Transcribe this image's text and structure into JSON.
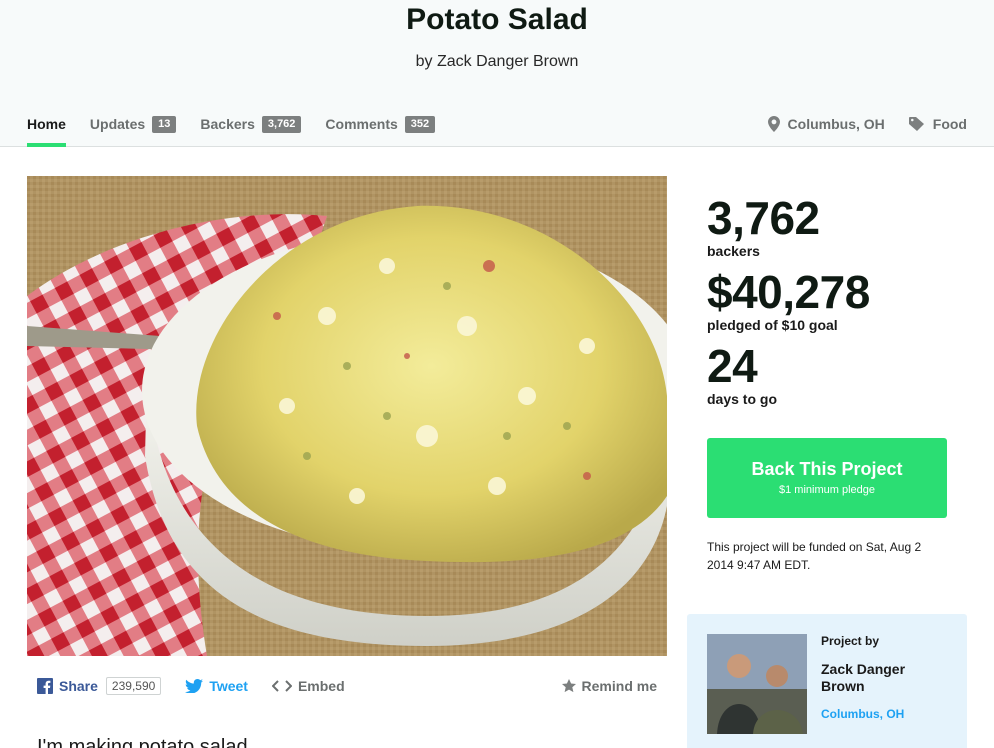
{
  "project": {
    "title": "Potato Salad",
    "byline": "by Zack Danger Brown"
  },
  "nav": {
    "home": "Home",
    "updates": {
      "label": "Updates",
      "count": "13"
    },
    "backers": {
      "label": "Backers",
      "count": "3,762"
    },
    "comments": {
      "label": "Comments",
      "count": "352"
    }
  },
  "meta": {
    "location": "Columbus, OH",
    "category": "Food"
  },
  "share": {
    "share_label": "Share",
    "share_count": "239,590",
    "tweet_label": "Tweet",
    "embed_label": "Embed",
    "remind_label": "Remind me"
  },
  "blurb_peek": "I'm making potato salad.",
  "stats": {
    "backers_value": "3,762",
    "backers_label": "backers",
    "pledged_value": "$40,278",
    "pledged_label": "pledged of $10 goal",
    "days_value": "24",
    "days_label": "days to go"
  },
  "cta": {
    "label": "Back This Project",
    "sublabel": "$1 minimum pledge"
  },
  "funding_note": "This project will be funded on Sat, Aug 2 2014 9:47 AM EDT.",
  "creator": {
    "project_by": "Project by",
    "name": "Zack Danger Brown",
    "location": "Columbus, OH"
  },
  "colors": {
    "accent_green": "#2bde73",
    "facebook_blue": "#3b5998",
    "twitter_blue": "#1ea1f2",
    "creator_card_bg": "#e5f3fc"
  },
  "icons": {
    "location": "map-pin-icon",
    "category": "tag-icon",
    "facebook": "facebook-icon",
    "twitter": "twitter-bird-icon",
    "embed": "code-brackets-icon",
    "remind": "star-icon"
  }
}
